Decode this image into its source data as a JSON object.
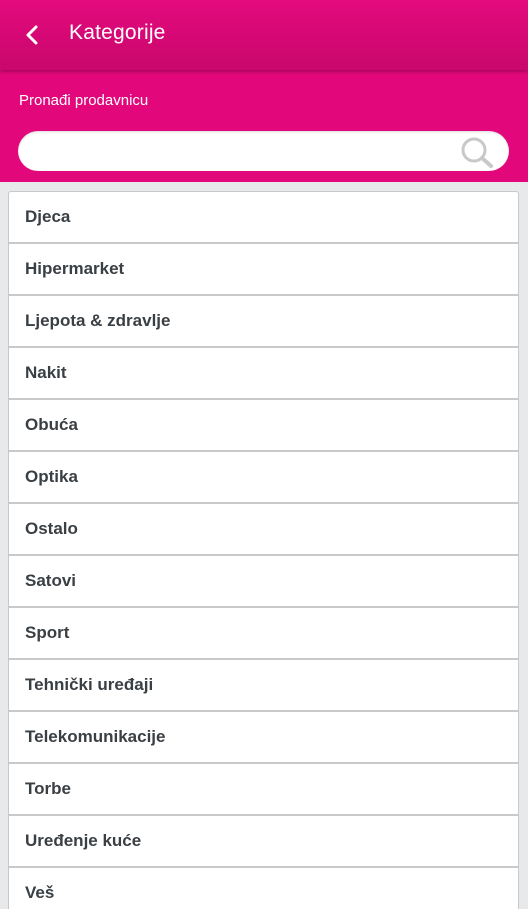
{
  "header": {
    "title": "Kategorije",
    "back_icon": "chevron-left-icon"
  },
  "search": {
    "label": "Pronađi prodavnicu",
    "value": "",
    "placeholder": "",
    "icon": "search-icon"
  },
  "colors": {
    "brand": "#e2087b",
    "brand_dark": "#c9076c",
    "text": "#3a3f44",
    "background": "#e8e9ea"
  },
  "categories": [
    {
      "label": "Djeca"
    },
    {
      "label": "Hipermarket"
    },
    {
      "label": "Ljepota & zdravlje"
    },
    {
      "label": "Nakit"
    },
    {
      "label": "Obuća"
    },
    {
      "label": "Optika"
    },
    {
      "label": "Ostalo"
    },
    {
      "label": "Satovi"
    },
    {
      "label": "Sport"
    },
    {
      "label": "Tehnički uređaji"
    },
    {
      "label": "Telekomunikacije"
    },
    {
      "label": "Torbe"
    },
    {
      "label": "Uređenje kuće"
    },
    {
      "label": "Veš"
    }
  ]
}
